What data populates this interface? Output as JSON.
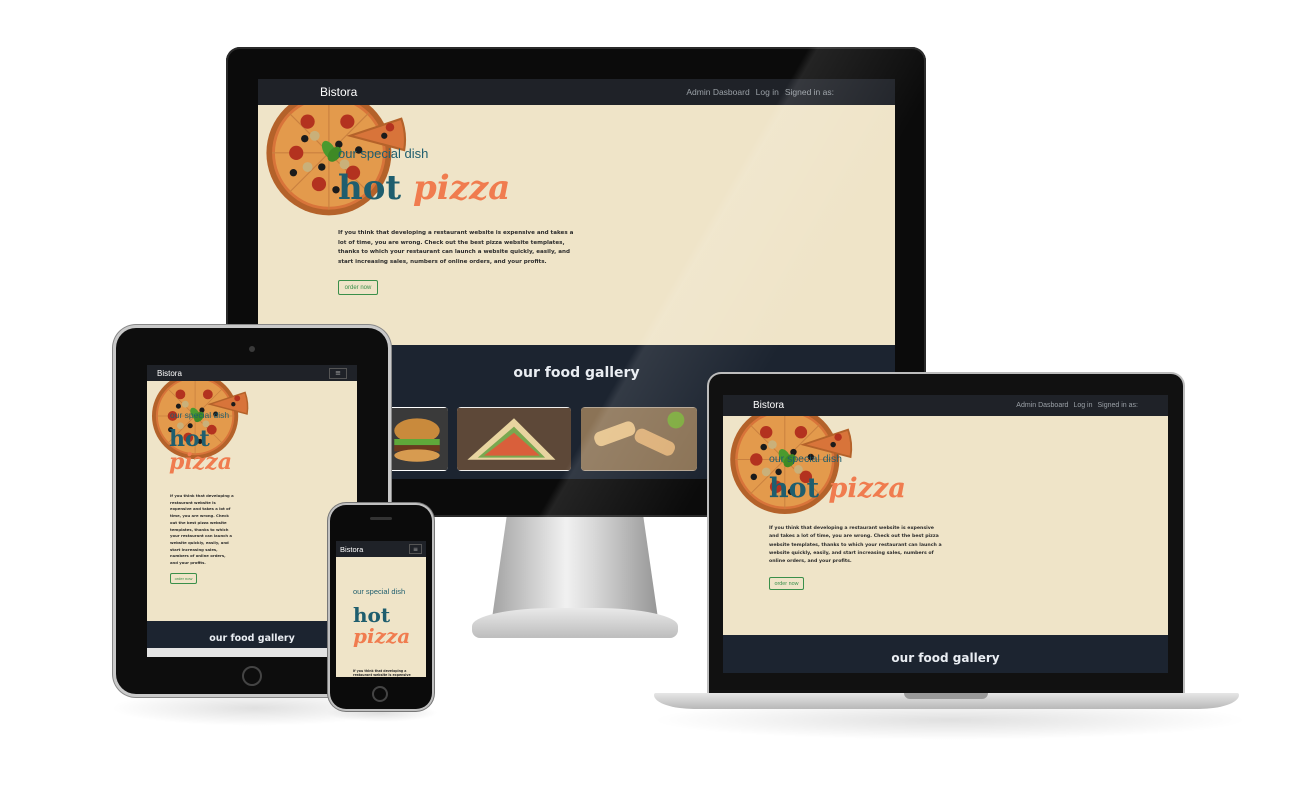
{
  "site": {
    "brand": "Bistora",
    "nav_links": [
      "Admin Dasboard",
      "Log in",
      "Signed in as:"
    ],
    "menu_icon": "hamburger-icon",
    "hero": {
      "eyebrow": "our special dish",
      "headline_word1": "hot",
      "headline_word2": "pizza",
      "description": "If you think that developing a restaurant website is expensive and takes a lot of time, you are wrong. Check out the best pizza website templates, thanks to which your restaurant can launch a website quickly, easily, and start increasing sales, numbers of online orders, and your profits.",
      "button": "order now"
    },
    "gallery": {
      "title": "our food gallery",
      "thumbnails": [
        "burger",
        "sandwich",
        "wraps"
      ]
    }
  },
  "colors": {
    "hero_bg": "#efe4c8",
    "nav_bg": "#1f2228",
    "teal": "#1f5e6e",
    "orange": "#f07c4f",
    "gallery_bg": "#1c2430",
    "button_green": "#3a8f4a"
  },
  "devices": [
    "desktop-monitor",
    "tablet",
    "laptop",
    "phone"
  ]
}
